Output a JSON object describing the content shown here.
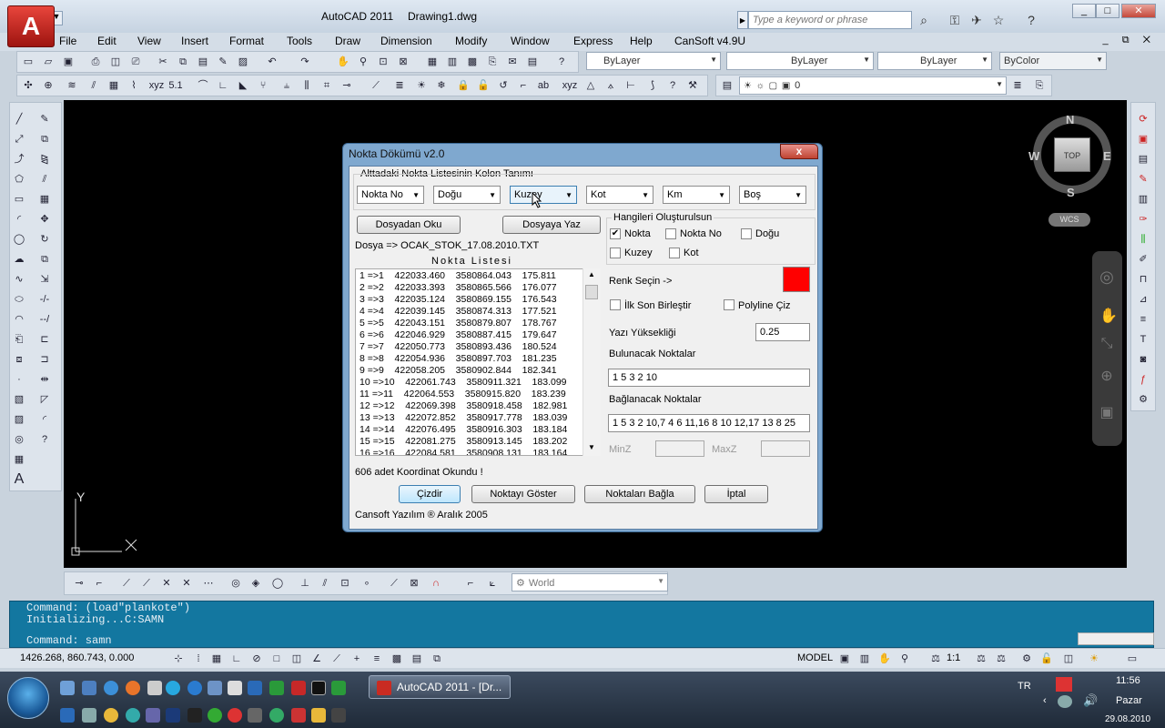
{
  "app": {
    "name": "AutoCAD 2011",
    "document": "Drawing1.dwg",
    "search_placeholder": "Type a keyword or phrase",
    "logo_letter": "A"
  },
  "menu": [
    "File",
    "Edit",
    "View",
    "Insert",
    "Format",
    "Tools",
    "Draw",
    "Dimension",
    "Modify",
    "Window",
    "Express",
    "Help",
    "CanSoft v4.9U"
  ],
  "properties": {
    "color": "ByLayer",
    "linetype": "ByLayer",
    "lineweight": "ByLayer",
    "plotstyle": "ByColor",
    "layer": "0"
  },
  "nav": {
    "north": "N",
    "south": "S",
    "east": "E",
    "west": "W",
    "cube": "TOP",
    "wcs": "WCS"
  },
  "ucs": {
    "y": "Y"
  },
  "workspace": "World",
  "command": {
    "line1": "Command: (load\"plankote\")",
    "line2": "Initializing...C:SAMN",
    "prompt": "Command: samn"
  },
  "status": {
    "coords": "1426.268, 860.743, 0.000",
    "model": "MODEL",
    "scale": "1:1"
  },
  "taskbar": {
    "task": "AutoCAD 2011 - [Dr...",
    "lang": "TR",
    "time": "11:56",
    "day": "Pazar",
    "date": "29.08.2010"
  },
  "dialog": {
    "title": "Nokta Dökümü v2.0",
    "close": "x",
    "column_group": "Alttadaki Nokta Listesinin Kolon Tanımı",
    "columns": [
      "Nokta No",
      "Doğu",
      "Kuzey",
      "Kot",
      "Km",
      "Boş"
    ],
    "read_btn": "Dosyadan Oku",
    "write_btn": "Dosyaya Yaz",
    "file_label": "Dosya => OCAK_STOK_17.08.2010.TXT",
    "list_title": "Nokta Listesi",
    "rows": [
      "1 =>1    422033.460    3580864.043    175.811",
      "2 =>2    422033.393    3580865.566    176.077",
      "3 =>3    422035.124    3580869.155    176.543",
      "4 =>4    422039.145    3580874.313    177.521",
      "5 =>5    422043.151    3580879.807    178.767",
      "6 =>6    422046.929    3580887.415    179.647",
      "7 =>7    422050.773    3580893.436    180.524",
      "8 =>8    422054.936    3580897.703    181.235",
      "9 =>9    422058.205    3580902.844    182.341",
      "10 =>10    422061.743    3580911.321    183.099",
      "11 =>11    422064.553    3580915.820    183.239",
      "12 =>12    422069.398    3580918.458    182.981",
      "13 =>13    422072.852    3580917.778    183.039",
      "14 =>14    422076.495    3580916.303    183.184",
      "15 =>15    422081.275    3580913.145    183.202",
      "16 =>16    422084.581    3580908.131    183.164"
    ],
    "count_label": "606 adet Koordinat Okundu !",
    "create_group": "Hangileri Oluşturulsun",
    "chk_nokta": "Nokta",
    "chk_noktano": "Nokta No",
    "chk_dogu": "Doğu",
    "chk_kuzey": "Kuzey",
    "chk_kot": "Kot",
    "color_label": "Renk Seçin ->",
    "color_value": "#ff0000",
    "chk_ilk": "İlk Son Birleştir",
    "chk_polyline": "Polyline Çiz",
    "height_label": "Yazı Yüksekliği",
    "height_value": "0.25",
    "find_label": "Bulunacak Noktalar",
    "find_value": "1 5 3 2 10",
    "connect_label": "Bağlanacak Noktalar",
    "connect_value": "1 5 3 2 10,7 4 6 11,16 8 10 12,17 13 8 25",
    "minz": "MinZ",
    "maxz": "MaxZ",
    "btn_draw": "Çizdir",
    "btn_show": "Noktayı Göster",
    "btn_connect": "Noktaları Bağla",
    "btn_cancel": "İptal",
    "footer": "Cansoft Yazılım ® Aralık 2005"
  }
}
